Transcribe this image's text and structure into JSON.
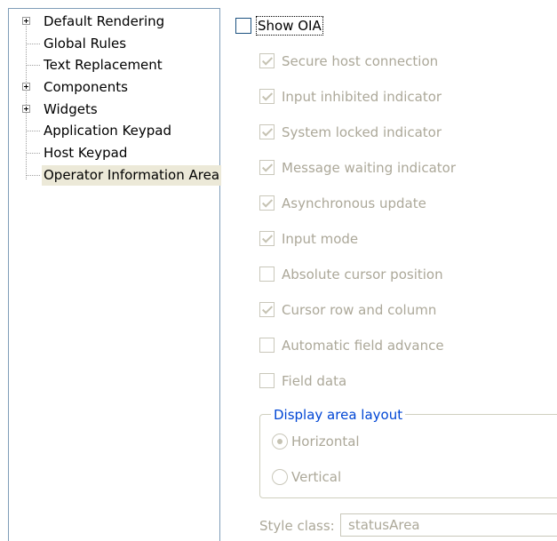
{
  "tree": {
    "items": [
      {
        "label": "Default Rendering",
        "expandable": true
      },
      {
        "label": "Global Rules",
        "expandable": false
      },
      {
        "label": "Text Replacement",
        "expandable": false
      },
      {
        "label": "Components",
        "expandable": true
      },
      {
        "label": "Widgets",
        "expandable": true
      },
      {
        "label": "Application Keypad",
        "expandable": false
      },
      {
        "label": "Host Keypad",
        "expandable": false
      },
      {
        "label": "Operator Information Area",
        "expandable": false,
        "selected": true
      }
    ]
  },
  "oia": {
    "show_label": "Show OIA",
    "show_checked": false,
    "options": [
      {
        "label": "Secure host connection",
        "checked": true
      },
      {
        "label": "Input inhibited indicator",
        "checked": true
      },
      {
        "label": "System locked indicator",
        "checked": true
      },
      {
        "label": "Message waiting indicator",
        "checked": true
      },
      {
        "label": "Asynchronous update",
        "checked": true
      },
      {
        "label": "Input mode",
        "checked": true
      },
      {
        "label": "Absolute cursor position",
        "checked": false
      },
      {
        "label": "Cursor row and column",
        "checked": true
      },
      {
        "label": "Automatic field advance",
        "checked": false
      },
      {
        "label": "Field data",
        "checked": false
      }
    ],
    "layout_group": {
      "title": "Display area layout",
      "horizontal_label": "Horizontal",
      "vertical_label": "Vertical",
      "selected": "Horizontal"
    },
    "style_class": {
      "label": "Style class:",
      "value": "statusArea"
    }
  }
}
